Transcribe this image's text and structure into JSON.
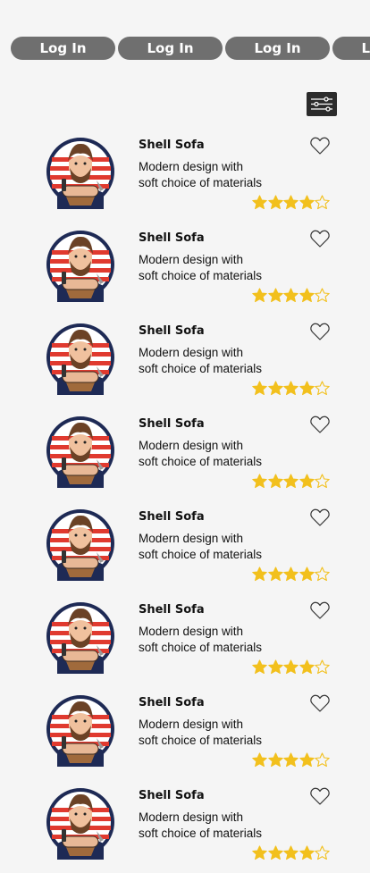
{
  "tabs": [
    "Log In",
    "Log In",
    "Log In",
    "Log In"
  ],
  "filter": {
    "icon": "sliders-icon"
  },
  "colors": {
    "tab_bg": "#6f6f6f",
    "star": "#f2c01d",
    "filter_bg": "#2b2b2b"
  },
  "products": [
    {
      "title": "Shell Sofa",
      "desc_line1": "Modern design with",
      "desc_line2": "soft choice of materials",
      "rating": 4,
      "max_rating": 5
    },
    {
      "title": "Shell Sofa",
      "desc_line1": "Modern design with",
      "desc_line2": "soft choice of materials",
      "rating": 4,
      "max_rating": 5
    },
    {
      "title": "Shell Sofa",
      "desc_line1": "Modern design with",
      "desc_line2": "soft choice of materials",
      "rating": 4,
      "max_rating": 5
    },
    {
      "title": "Shell Sofa",
      "desc_line1": "Modern design with",
      "desc_line2": "soft choice of materials",
      "rating": 4,
      "max_rating": 5
    },
    {
      "title": "Shell Sofa",
      "desc_line1": "Modern design with",
      "desc_line2": "soft choice of materials",
      "rating": 4,
      "max_rating": 5
    },
    {
      "title": "Shell Sofa",
      "desc_line1": "Modern design with",
      "desc_line2": "soft choice of materials",
      "rating": 4,
      "max_rating": 5
    },
    {
      "title": "Shell Sofa",
      "desc_line1": "Modern design with",
      "desc_line2": "soft choice of materials",
      "rating": 4,
      "max_rating": 5
    },
    {
      "title": "Shell Sofa",
      "desc_line1": "Modern design with",
      "desc_line2": "soft choice of materials",
      "rating": 4,
      "max_rating": 5
    }
  ]
}
